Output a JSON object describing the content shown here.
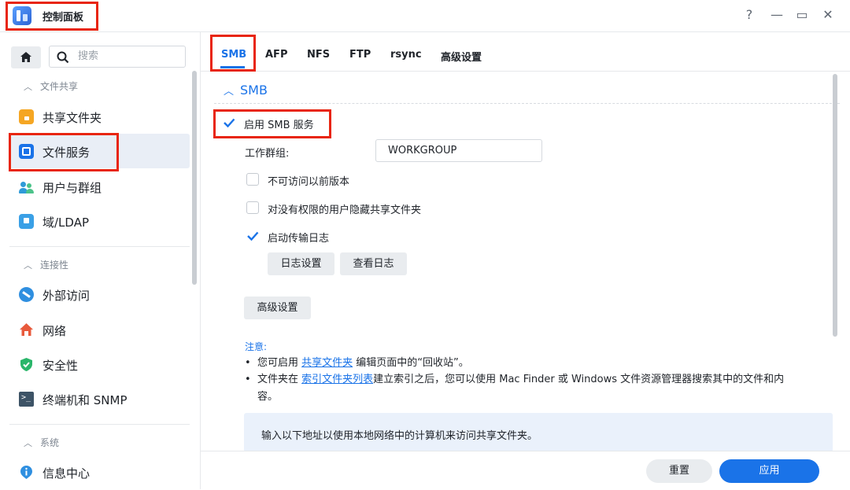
{
  "app": {
    "title": "控制面板"
  },
  "window_controls": {
    "help": "?",
    "minimize": "—",
    "maximize": "▭",
    "close": "✕"
  },
  "sidebar": {
    "search_placeholder": "搜索",
    "sections": [
      {
        "title": "文件共享",
        "items": [
          {
            "label": "共享文件夹",
            "icon": "shared-folder-icon",
            "color": "#f5a623"
          },
          {
            "label": "文件服务",
            "icon": "file-services-icon",
            "color": "#1a73e8",
            "active": true
          },
          {
            "label": "用户与群组",
            "icon": "users-icon",
            "color": "#2f9bd8"
          },
          {
            "label": "域/LDAP",
            "icon": "domain-icon",
            "color": "#3aa0e6"
          }
        ]
      },
      {
        "title": "连接性",
        "items": [
          {
            "label": "外部访问",
            "icon": "external-access-icon",
            "color": "#2f8fe0"
          },
          {
            "label": "网络",
            "icon": "network-house-icon",
            "color": "#e85a3c"
          },
          {
            "label": "安全性",
            "icon": "shield-icon",
            "color": "#2ab66a"
          },
          {
            "label": "终端机和 SNMP",
            "icon": "terminal-icon",
            "color": "#3d5366"
          }
        ]
      },
      {
        "title": "系统",
        "items": [
          {
            "label": "信息中心",
            "icon": "info-icon",
            "color": "#2f8fe0"
          }
        ]
      }
    ]
  },
  "tabs": [
    "SMB",
    "AFP",
    "NFS",
    "FTP",
    "rsync",
    "高级设置"
  ],
  "smb": {
    "section_title": "SMB",
    "enable_label": "启用 SMB 服务",
    "enable_checked": true,
    "workgroup_label": "工作群组:",
    "workgroup_value": "WORKGROUP",
    "no_prev_versions_label": "不可访问以前版本",
    "no_prev_versions_checked": false,
    "hide_shares_label": "对没有权限的用户隐藏共享文件夹",
    "hide_shares_checked": false,
    "transfer_log_label": "启动传输日志",
    "transfer_log_checked": true,
    "log_settings_button": "日志设置",
    "view_logs_button": "查看日志",
    "advanced_button": "高级设置"
  },
  "notes": {
    "title": "注意:",
    "line1_prefix": "您可启用",
    "line1_link": "共享文件夹",
    "line1_suffix": "编辑页面中的“回收站”。",
    "line2_prefix": "文件夹在",
    "line2_link": "索引文件夹列表",
    "line2_suffix": "建立索引之后，您可以使用 Mac Finder 或 Windows 文件资源管理器搜索其中的文件和内",
    "line2_cont": "容。",
    "info": "输入以下地址以使用本地网络中的计算机来访问共享文件夹。"
  },
  "footer": {
    "reset": "重置",
    "apply": "应用"
  }
}
